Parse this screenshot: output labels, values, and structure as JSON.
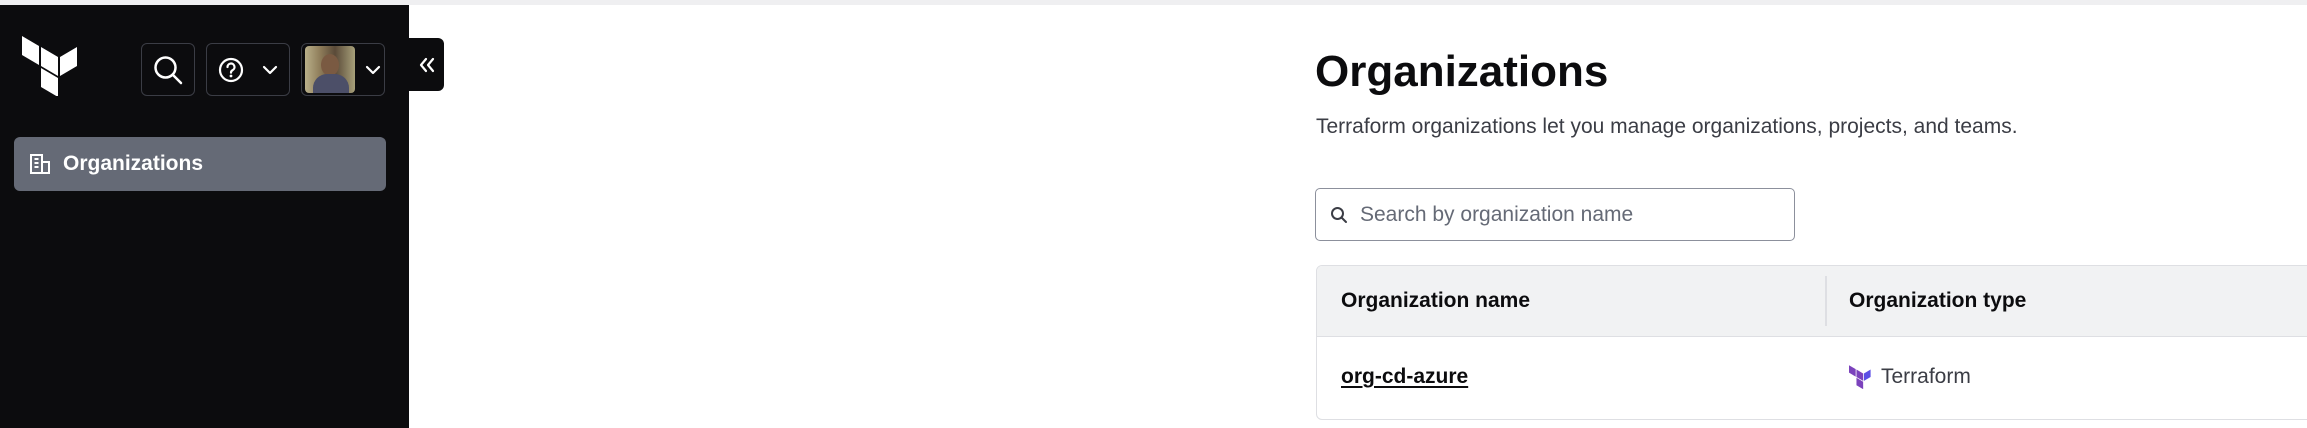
{
  "sidebar": {
    "logo": "terraform-logo",
    "buttons": {
      "search_icon": "search-icon",
      "help_icon": "help-icon",
      "user_icon": "avatar",
      "dropdown_icon": "chevron-down-icon"
    },
    "items": [
      {
        "label": "Organizations",
        "icon": "building-icon",
        "active": true
      }
    ],
    "collapse_icon": "chevrons-left-icon"
  },
  "main": {
    "title": "Organizations",
    "description": "Terraform organizations let you manage organizations, projects, and teams.",
    "search": {
      "placeholder": "Search by organization name",
      "value": ""
    },
    "table": {
      "columns": [
        "Organization name",
        "Organization type"
      ],
      "rows": [
        {
          "name": "org-cd-azure",
          "type": "Terraform",
          "type_icon": "terraform-logo-icon"
        }
      ]
    }
  },
  "colors": {
    "sidebar_bg": "#0c0c0e",
    "active_item_bg": "#656a76",
    "terraform_purple": "#7b42bc",
    "table_header_bg": "#f1f2f3",
    "border": "#dedfe3"
  }
}
